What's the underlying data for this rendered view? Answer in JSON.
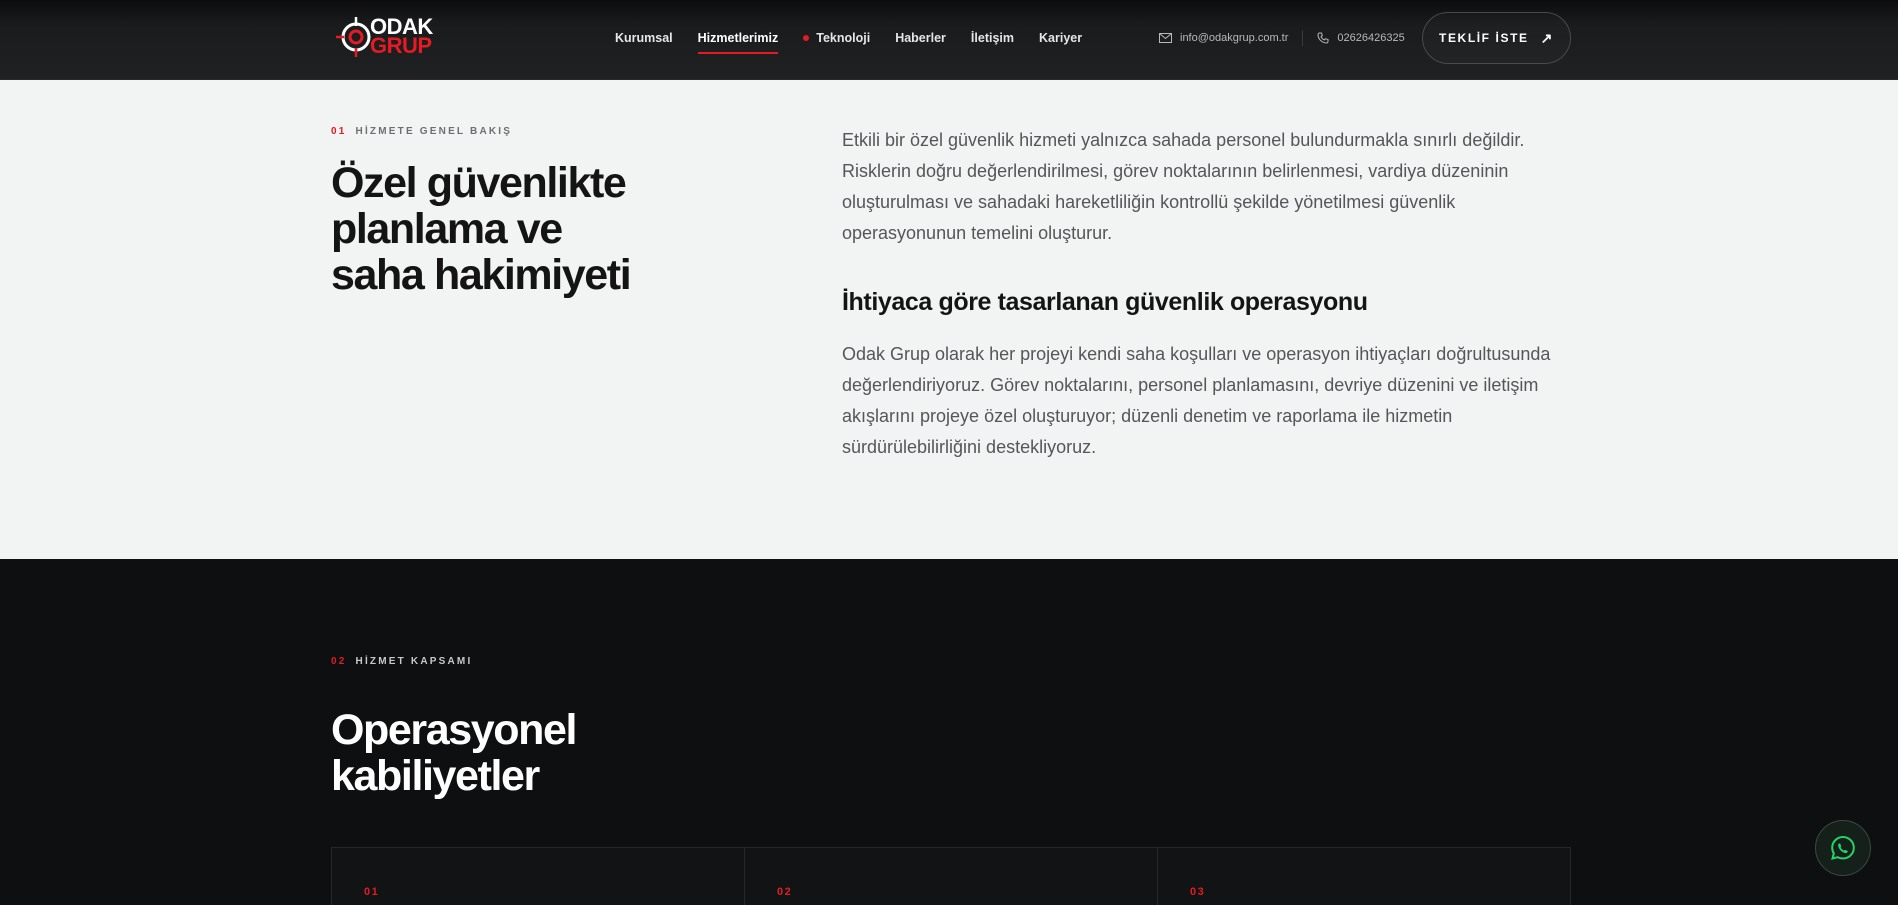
{
  "header": {
    "logo": {
      "line1": "ODAK",
      "line2": "GRUP"
    },
    "nav": [
      {
        "label": "Kurumsal",
        "active": false,
        "dot": false
      },
      {
        "label": "Hizmetlerimiz",
        "active": true,
        "dot": false
      },
      {
        "label": "Teknoloji",
        "active": false,
        "dot": true
      },
      {
        "label": "Haberler",
        "active": false,
        "dot": false
      },
      {
        "label": "İletişim",
        "active": false,
        "dot": false
      },
      {
        "label": "Kariyer",
        "active": false,
        "dot": false
      }
    ],
    "email": "info@odakgrup.com.tr",
    "phone": "02626426325",
    "cta_label": "TEKLİF İSTE",
    "cta_icon": "arrow-up-right-icon"
  },
  "overview": {
    "number": "01",
    "eyebrow": "HİZMETE GENEL BAKIŞ",
    "title_lines": [
      "Özel güvenlikte",
      "planlama ve",
      "saha hakimiyeti"
    ],
    "paragraph1": "Etkili bir özel güvenlik hizmeti yalnızca sahada personel bulundurmakla sınırlı değildir. Risklerin doğru değerlendirilmesi, görev noktalarının belirlenmesi, vardiya düzeninin oluşturulması ve sahadaki hareketliliğin kontrollü şekilde yönetilmesi güvenlik operasyonunun temelini oluşturur.",
    "subheading": "İhtiyaca göre tasarlanan güvenlik operasyonu",
    "paragraph2": "Odak Grup olarak her projeyi kendi saha koşulları ve operasyon ihtiyaçları doğrultusunda değerlendiriyoruz. Görev noktalarını, personel planlamasını, devriye düzenini ve iletişim akışlarını projeye özel oluşturuyor; düzenli denetim ve raporlama ile hizmetin sürdürülebilirliğini destekliyoruz."
  },
  "scope": {
    "number": "02",
    "eyebrow": "HİZMET KAPSAMI",
    "title_lines": [
      "Operasyonel",
      "kabiliyetler"
    ],
    "cards": [
      {
        "number": "01"
      },
      {
        "number": "02"
      },
      {
        "number": "03"
      }
    ]
  },
  "colors": {
    "accent": "#e41b23",
    "dark_bg": "#0e0f11",
    "light_bg": "#f2f3f3",
    "whatsapp": "#25d366"
  },
  "floating": {
    "icon": "whatsapp-icon"
  }
}
